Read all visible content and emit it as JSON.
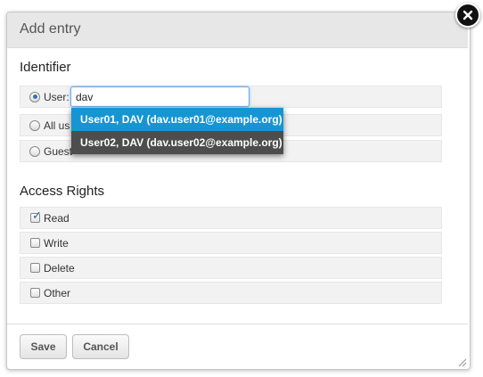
{
  "dialog": {
    "title": "Add entry",
    "close_icon": "close-icon"
  },
  "identifier": {
    "heading": "Identifier",
    "options": [
      {
        "label": "User:",
        "selected": true
      },
      {
        "label": "All us",
        "selected": false
      },
      {
        "label": "Guest",
        "selected": false
      }
    ],
    "user_input_value": "dav"
  },
  "autocomplete": {
    "items": [
      {
        "label": "User01, DAV (dav.user01@example.org)",
        "highlighted": true
      },
      {
        "label": "User02, DAV (dav.user02@example.org)",
        "highlighted": false
      }
    ]
  },
  "access_rights": {
    "heading": "Access Rights",
    "items": [
      {
        "label": "Read",
        "checked": true
      },
      {
        "label": "Write",
        "checked": false
      },
      {
        "label": "Delete",
        "checked": false
      },
      {
        "label": "Other",
        "checked": false
      }
    ]
  },
  "buttons": {
    "save": "Save",
    "cancel": "Cancel"
  },
  "colors": {
    "highlight": "#1596d3",
    "dropdown_dark": "#4d4d4d",
    "input_focus": "#6aa9e8"
  }
}
